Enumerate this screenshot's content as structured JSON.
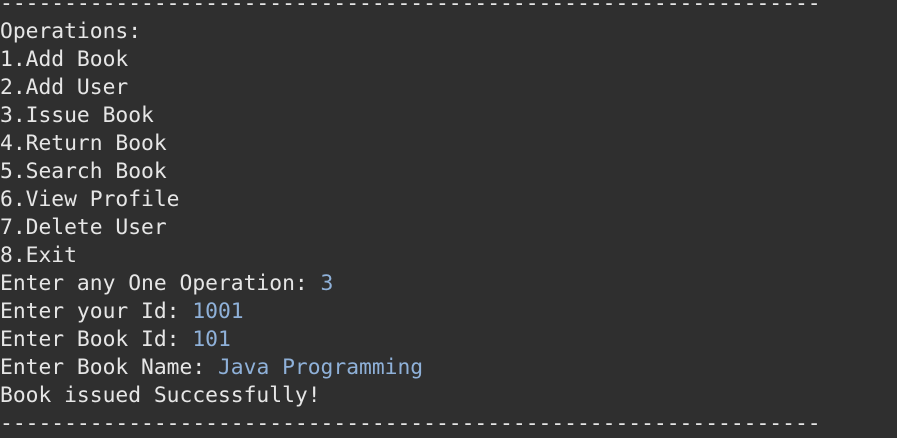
{
  "colors": {
    "background": "#2f2f2f",
    "text": "#e6e6e6",
    "user_input": "#8fb1d9"
  },
  "separator": "----------------------------------------------------------------",
  "menu": {
    "heading": "Operations:",
    "items": [
      "1.Add Book",
      "2.Add User",
      "3.Issue Book",
      "4.Return Book",
      "5.Search Book",
      "6.View Profile",
      "7.Delete User",
      "8.Exit"
    ]
  },
  "prompts": [
    {
      "label": "Enter any One Operation: ",
      "value": "3"
    },
    {
      "label": "Enter your Id: ",
      "value": "1001"
    },
    {
      "label": "Enter Book Id: ",
      "value": "101"
    },
    {
      "label": "Enter Book Name: ",
      "value": "Java Programming"
    }
  ],
  "result_message": "Book issued Successfully!"
}
